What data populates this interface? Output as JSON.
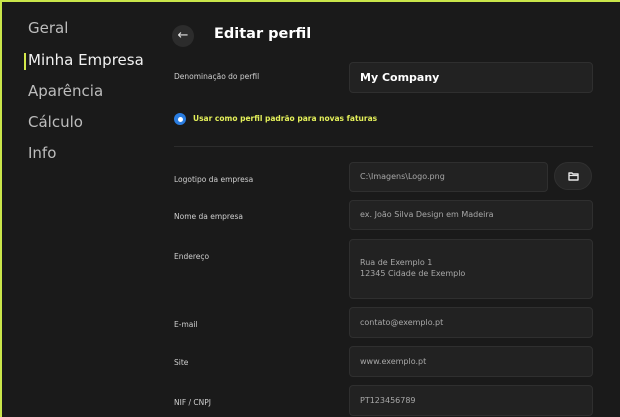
{
  "sidebar": {
    "items": [
      {
        "label": "Geral"
      },
      {
        "label": "Minha Empresa"
      },
      {
        "label": "Aparência"
      },
      {
        "label": "Cálculo"
      },
      {
        "label": "Info"
      }
    ],
    "active_index": 1
  },
  "header": {
    "back_icon": "arrow-left-icon",
    "title": "Editar perfil"
  },
  "form": {
    "profile_name": {
      "label": "Denominação do perfil",
      "value": "My Company"
    },
    "default_option": {
      "label": "Usar como perfil padrão para novas faturas",
      "checked": true
    },
    "logo": {
      "label": "Logotipo da empresa",
      "value": "C:\\Imagens\\Logo.png",
      "browse_icon": "folder-icon"
    },
    "company_name": {
      "label": "Nome da empresa",
      "placeholder": "ex. João Silva Design em Madeira"
    },
    "address": {
      "label": "Endereço",
      "line1": "Rua de Exemplo 1",
      "line2": "12345 Cidade de Exemplo"
    },
    "email": {
      "label": "E-mail",
      "placeholder": "contato@exemplo.pt"
    },
    "site": {
      "label": "Site",
      "placeholder": "www.exemplo.pt"
    },
    "tax_id": {
      "label": "NIF / CNPJ",
      "placeholder": "PT123456789"
    }
  },
  "colors": {
    "accent_frame": "#c9e64a",
    "radio_blue": "#2a7de1",
    "highlight_text": "#e4f05a",
    "background": "#1a1a1a"
  }
}
